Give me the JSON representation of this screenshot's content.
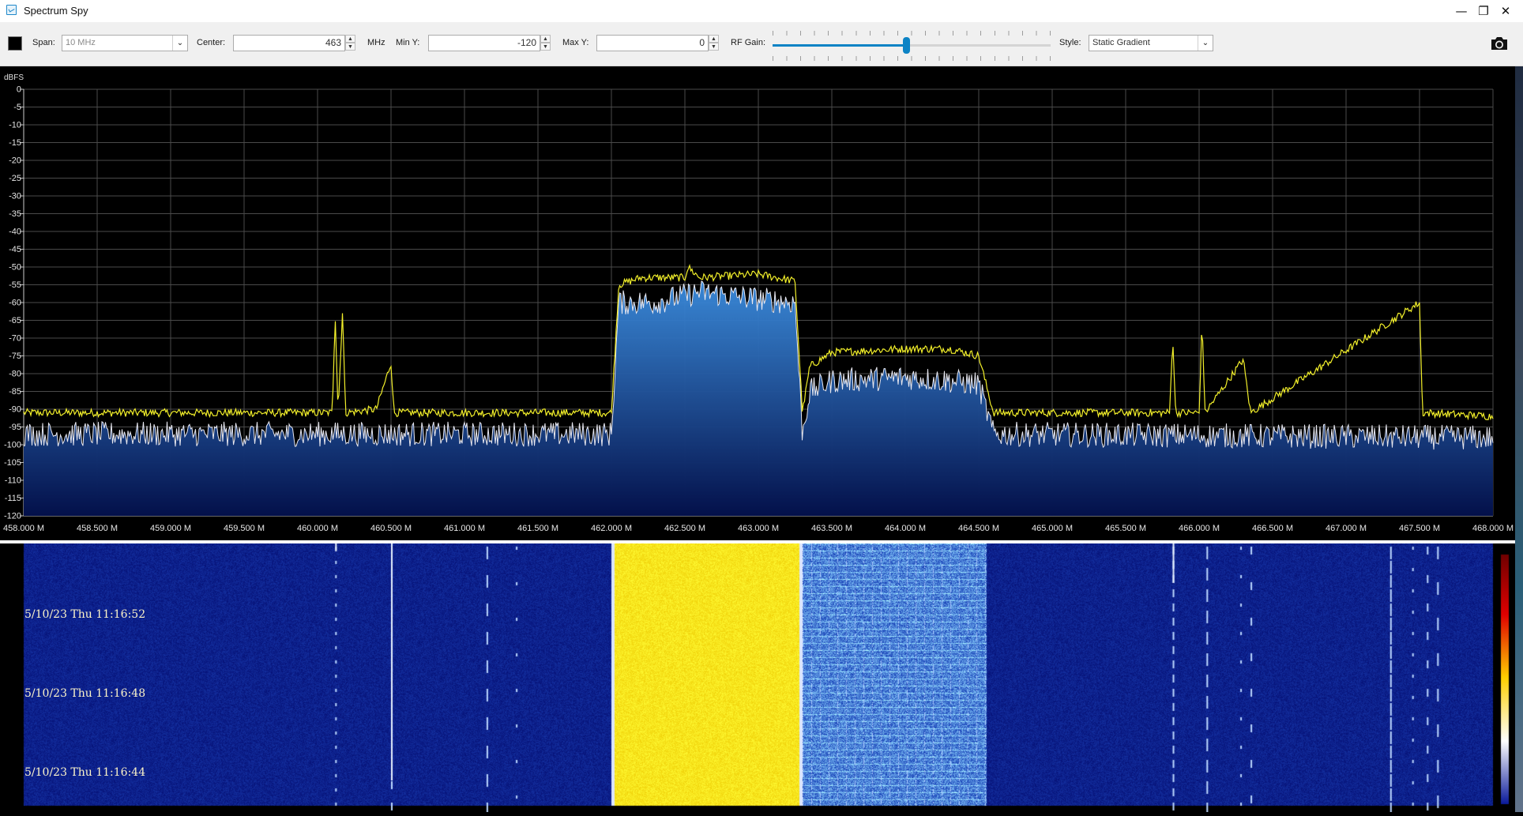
{
  "window": {
    "title": "Spectrum Spy",
    "controls": {
      "minimize": "—",
      "maximize": "❐",
      "close": "✕"
    }
  },
  "toolbar": {
    "span_label": "Span:",
    "span_value": "10 MHz",
    "center_label": "Center:",
    "center_value": "463",
    "center_unit": "MHz",
    "miny_label": "Min Y:",
    "miny_value": "-120",
    "maxy_label": "Max Y:",
    "maxy_value": "0",
    "rfgain_label": "RF Gain:",
    "rfgain_level": 0.48,
    "style_label": "Style:",
    "style_value": "Static Gradient",
    "dropdown_glyph": "⌄",
    "spin_up": "▲",
    "spin_down": "▼"
  },
  "spectrum": {
    "y_unit": "dBFS",
    "y_ticks": [
      "0",
      "-5",
      "-10",
      "-15",
      "-20",
      "-25",
      "-30",
      "-35",
      "-40",
      "-45",
      "-50",
      "-55",
      "-60",
      "-65",
      "-70",
      "-75",
      "-80",
      "-85",
      "-90",
      "-95",
      "-100",
      "-105",
      "-110",
      "-115",
      "-120"
    ],
    "x_ticks": [
      "458.000 M",
      "458.500 M",
      "459.000 M",
      "459.500 M",
      "460.000 M",
      "460.500 M",
      "461.000 M",
      "461.500 M",
      "462.000 M",
      "462.500 M",
      "463.000 M",
      "463.500 M",
      "464.000 M",
      "464.500 M",
      "465.000 M",
      "465.500 M",
      "466.000 M",
      "466.500 M",
      "467.000 M",
      "467.500 M",
      "468.000 M"
    ],
    "colors": {
      "peak": "#f2ef2a",
      "live": "#e8e8f0",
      "grid": "#4a4a4a",
      "fill_top": "#3c8ee0",
      "fill_bottom": "#03104a"
    }
  },
  "chart_data": {
    "type": "line",
    "title": "",
    "xlabel": "",
    "ylabel": "dBFS",
    "xlim": [
      458.0,
      468.0
    ],
    "ylim": [
      -120,
      0
    ],
    "grid": true,
    "series": [
      {
        "values": [
          [
            458.0,
            -91
          ],
          [
            460.1,
            -91
          ],
          [
            460.12,
            -63
          ],
          [
            460.14,
            -91
          ],
          [
            460.17,
            -62
          ],
          [
            460.19,
            -91
          ],
          [
            460.4,
            -90
          ],
          [
            460.5,
            -77
          ],
          [
            460.52,
            -91
          ],
          [
            462.0,
            -91
          ],
          [
            462.05,
            -55
          ],
          [
            462.2,
            -53
          ],
          [
            462.5,
            -53
          ],
          [
            462.52,
            -50
          ],
          [
            462.6,
            -53
          ],
          [
            463.0,
            -52
          ],
          [
            463.25,
            -54
          ],
          [
            463.3,
            -91
          ],
          [
            463.35,
            -78
          ],
          [
            463.5,
            -74
          ],
          [
            464.0,
            -73
          ],
          [
            464.3,
            -73
          ],
          [
            464.5,
            -75
          ],
          [
            464.6,
            -91
          ],
          [
            465.8,
            -91
          ],
          [
            465.82,
            -69
          ],
          [
            465.84,
            -91
          ],
          [
            466.0,
            -91
          ],
          [
            466.02,
            -65
          ],
          [
            466.04,
            -91
          ],
          [
            466.3,
            -76
          ],
          [
            466.35,
            -91
          ],
          [
            467.5,
            -60
          ],
          [
            467.52,
            -91
          ],
          [
            468.0,
            -92
          ]
        ]
      },
      {
        "values": [
          [
            458.0,
            -97
          ],
          [
            462.0,
            -97
          ],
          [
            462.05,
            -60
          ],
          [
            462.3,
            -60
          ],
          [
            462.6,
            -57
          ],
          [
            463.0,
            -59
          ],
          [
            463.25,
            -60
          ],
          [
            463.3,
            -97
          ],
          [
            463.35,
            -85
          ],
          [
            463.5,
            -82
          ],
          [
            464.0,
            -81
          ],
          [
            464.3,
            -82
          ],
          [
            464.5,
            -83
          ],
          [
            464.6,
            -97
          ],
          [
            468.0,
            -98
          ]
        ]
      }
    ]
  },
  "waterfall": {
    "timestamps": [
      "5/10/23 Thu 11:16:52",
      "5/10/23 Thu 11:16:48",
      "5/10/23 Thu 11:16:44"
    ],
    "colors": {
      "background": "#06148c",
      "hot": "#f4e20c",
      "warm": "#2c6ee6",
      "label": "#fbf3c8"
    }
  }
}
